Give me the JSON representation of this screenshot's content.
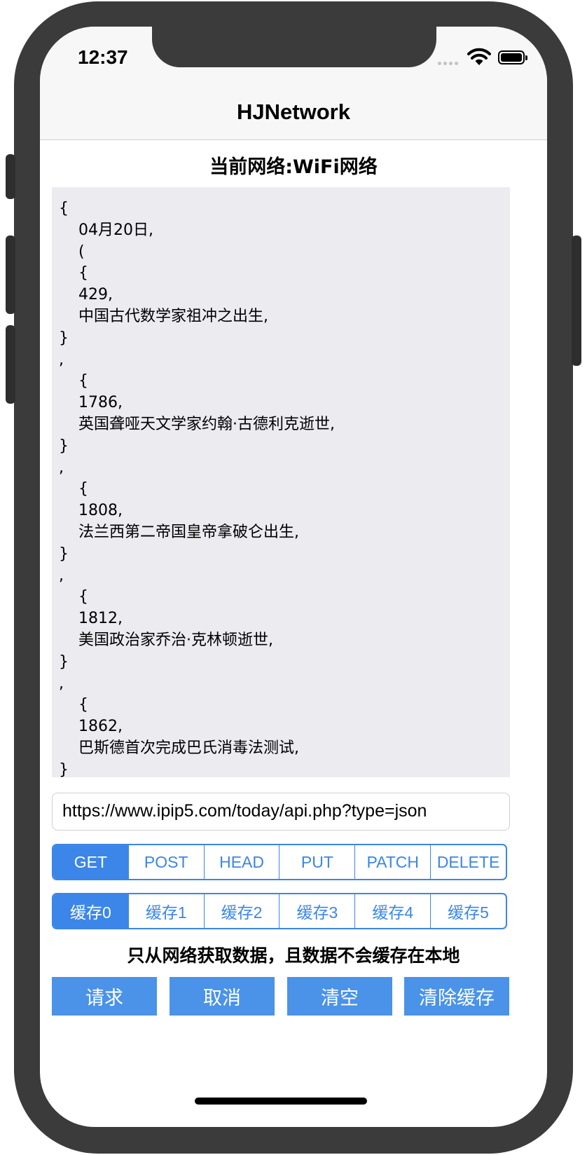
{
  "status_bar": {
    "time": "12:37"
  },
  "navbar": {
    "title": "HJNetwork"
  },
  "network_status": "当前网络:WiFi网络",
  "response_text": "{\n    04月20日,\n    (\n    {\n    429,\n    中国古代数学家祖冲之出生,\n}\n,\n    {\n    1786,\n    英国聋哑天文学家约翰·古德利克逝世,\n}\n,\n    {\n    1808,\n    法兰西第二帝国皇帝拿破仑出生,\n}\n,\n    {\n    1812,\n    美国政治家乔治·克林顿逝世,\n}\n,\n    {\n    1862,\n    巴斯德首次完成巴氏消毒法测试,\n}",
  "url_input": {
    "value": "https://www.ipip5.com/today/api.php?type=json"
  },
  "methods": {
    "selected": "GET",
    "options": [
      "GET",
      "POST",
      "HEAD",
      "PUT",
      "PATCH",
      "DELETE"
    ]
  },
  "cache_modes": {
    "selected": "缓存0",
    "options": [
      "缓存0",
      "缓存1",
      "缓存2",
      "缓存3",
      "缓存4",
      "缓存5"
    ]
  },
  "cache_description": "只从网络获取数据，且数据不会缓存在本地",
  "actions": {
    "request": "请求",
    "cancel": "取消",
    "clear": "清空",
    "clear_cache": "清除缓存"
  },
  "colors": {
    "accent": "#3b86e8",
    "button_bg": "#4a93e8",
    "output_bg": "#ebebf0",
    "device_frame": "#3b3b3b"
  }
}
